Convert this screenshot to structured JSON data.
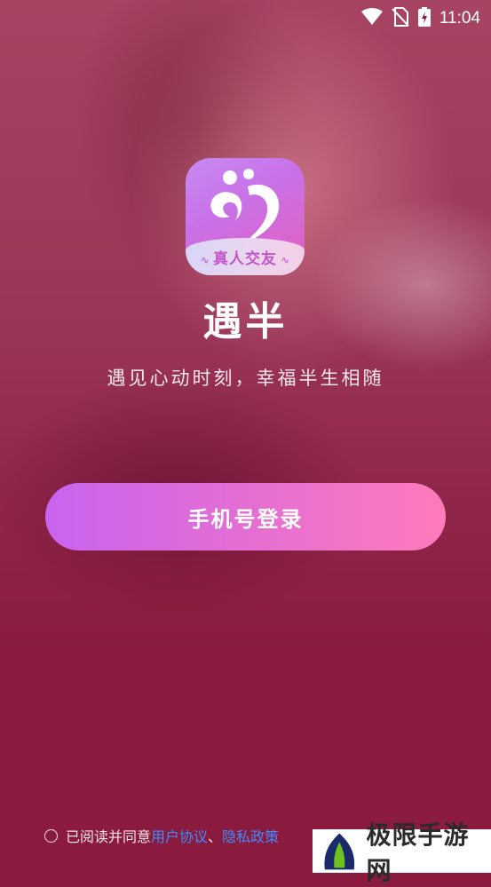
{
  "status_bar": {
    "time": "11:04",
    "icons": [
      "wifi-icon",
      "no-sim-icon",
      "battery-charging-icon"
    ]
  },
  "app": {
    "logo_tag": "真人交友",
    "name": "遇半",
    "slogan": "遇见心动时刻，幸福半生相随"
  },
  "login": {
    "button_label": "手机号登录"
  },
  "agreement": {
    "prefix": "已阅读并同意",
    "user_agreement": "用户协议",
    "separator": "、",
    "privacy_policy": "隐私政策"
  },
  "watermark": {
    "text": "极限手游网"
  },
  "colors": {
    "background": "#8a1b3e",
    "button_start": "#c864ef",
    "button_end": "#ff7bbb",
    "link": "#3f8bff"
  }
}
